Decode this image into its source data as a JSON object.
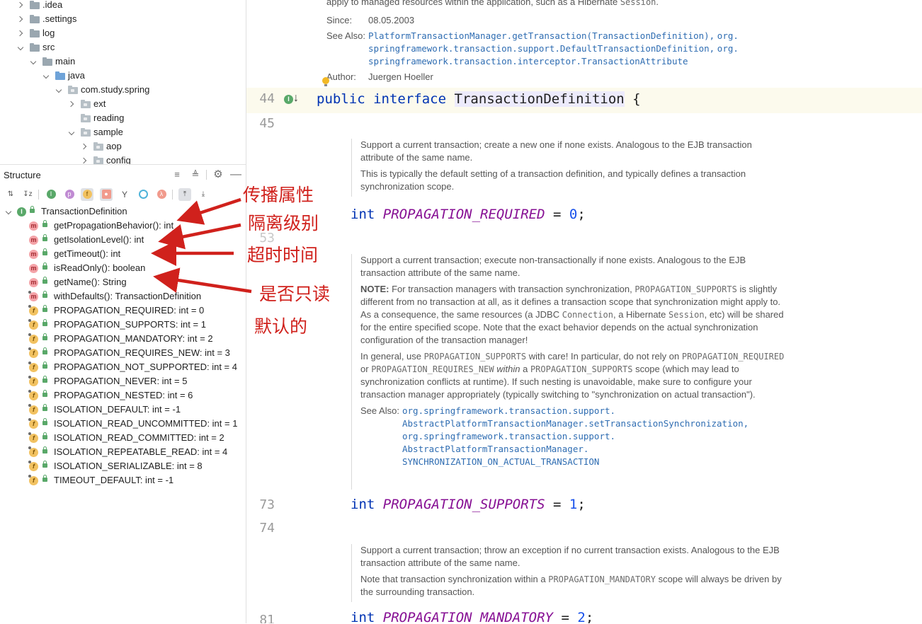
{
  "project_tree": {
    "items": [
      {
        "label": ".idea",
        "type": "folder"
      },
      {
        "label": ".settings",
        "type": "folder"
      },
      {
        "label": "log",
        "type": "folder"
      },
      {
        "label": "src",
        "type": "folder"
      },
      {
        "label": "main",
        "type": "folder"
      },
      {
        "label": "java",
        "type": "source-folder"
      },
      {
        "label": "com.study.spring",
        "type": "package"
      },
      {
        "label": "ext",
        "type": "package"
      },
      {
        "label": "reading",
        "type": "package"
      },
      {
        "label": "sample",
        "type": "package"
      },
      {
        "label": "aop",
        "type": "package"
      },
      {
        "label": "config",
        "type": "package"
      }
    ]
  },
  "structure": {
    "title": "Structure",
    "root": "TransactionDefinition",
    "members": [
      {
        "kind": "method",
        "label": "getPropagationBehavior(): int"
      },
      {
        "kind": "method",
        "label": "getIsolationLevel(): int"
      },
      {
        "kind": "method",
        "label": "getTimeout(): int"
      },
      {
        "kind": "method",
        "label": "isReadOnly(): boolean"
      },
      {
        "kind": "method",
        "label": "getName(): String"
      },
      {
        "kind": "static-method",
        "label": "withDefaults(): TransactionDefinition"
      },
      {
        "kind": "field",
        "label": "PROPAGATION_REQUIRED: int = 0"
      },
      {
        "kind": "field",
        "label": "PROPAGATION_SUPPORTS: int = 1"
      },
      {
        "kind": "field",
        "label": "PROPAGATION_MANDATORY: int = 2"
      },
      {
        "kind": "field",
        "label": "PROPAGATION_REQUIRES_NEW: int = 3"
      },
      {
        "kind": "field",
        "label": "PROPAGATION_NOT_SUPPORTED: int = 4"
      },
      {
        "kind": "field",
        "label": "PROPAGATION_NEVER: int = 5"
      },
      {
        "kind": "field",
        "label": "PROPAGATION_NESTED: int = 6"
      },
      {
        "kind": "field",
        "label": "ISOLATION_DEFAULT: int = -1"
      },
      {
        "kind": "field",
        "label": "ISOLATION_READ_UNCOMMITTED: int = 1"
      },
      {
        "kind": "field",
        "label": "ISOLATION_READ_COMMITTED: int = 2"
      },
      {
        "kind": "field",
        "label": "ISOLATION_REPEATABLE_READ: int = 4"
      },
      {
        "kind": "field",
        "label": "ISOLATION_SERIALIZABLE: int = 8"
      },
      {
        "kind": "field",
        "label": "TIMEOUT_DEFAULT: int = -1"
      }
    ]
  },
  "annotations": {
    "propagation": "传播属性",
    "isolation": "隔离级别",
    "timeout": "超时时间",
    "readonly": "是否只读",
    "default": "默认的",
    "color": "#d0211c"
  },
  "editor": {
    "top_doc": {
      "desc": "apply to managed resources within the application, such as a Hibernate",
      "desc_code": "Session",
      "desc_end": ".",
      "since_label": "Since:",
      "since_value": "08.05.2003",
      "see_also_label": "See Also:",
      "see_also_1": "PlatformTransactionManager.getTransaction(TransactionDefinition),",
      "see_also_2": "org.",
      "see_also_3": "springframework.transaction.support.DefaultTransactionDefinition,",
      "see_also_4": "org.",
      "see_also_5": "springframework.transaction.interceptor.TransactionAttribute",
      "author_label": "Author:",
      "author_value": "Juergen Hoeller"
    },
    "line_44": {
      "num": "44",
      "kw1": "public",
      "kw2": "interface",
      "type": "TransactionDefinition",
      "brace": "{"
    },
    "line_45": "45",
    "doc_required": {
      "p1": "Support a current transaction; create a new one if none exists. Analogous to the EJB transaction attribute of the same name.",
      "p2": "This is typically the default setting of a transaction definition, and typically defines a transaction synchronization scope."
    },
    "code_required": {
      "kw": "int",
      "name": "PROPAGATION_REQUIRED",
      "eq": "=",
      "value": "0",
      "semi": ";"
    },
    "line_53": "53",
    "doc_supports": {
      "p1": "Support a current transaction; execute non-transactionally if none exists. Analogous to the EJB transaction attribute of the same name.",
      "note_label": "NOTE:",
      "p2_a": "For transaction managers with transaction synchronization,",
      "p2_code1": "PROPAGATION_SUPPORTS",
      "p2_b": "is slightly different from no transaction at all, as it defines a transaction scope that synchronization might apply to. As a consequence, the same resources (a JDBC",
      "p2_code2": "Connection",
      "p2_c": ", a Hibernate",
      "p2_code3": "Session",
      "p2_d": ", etc) will be shared for the entire specified scope. Note that the exact behavior depends on the actual synchronization configuration of the transaction manager!",
      "p3_a": "In general, use",
      "p3_code1": "PROPAGATION_SUPPORTS",
      "p3_b": "with care! In particular, do not rely on",
      "p3_code2": "PROPAGATION_REQUIRED",
      "p3_c": "or",
      "p3_code3": "PROPAGATION_REQUIRES_NEW",
      "p3_em": "within",
      "p3_d": "a",
      "p3_code4": "PROPAGATION_SUPPORTS",
      "p3_e": "scope (which may lead to synchronization conflicts at runtime). If such nesting is unavoidable, make sure to configure your transaction manager appropriately (typically switching to \"synchronization on actual transaction\").",
      "see_label": "See Also:",
      "see_1": "org.springframework.transaction.support.",
      "see_2": "AbstractPlatformTransactionManager.setTransactionSynchronization,",
      "see_3": "org.springframework.transaction.support.",
      "see_4": "AbstractPlatformTransactionManager.",
      "see_5": "SYNCHRONIZATION_ON_ACTUAL_TRANSACTION"
    },
    "line_73": "73",
    "code_supports": {
      "kw": "int",
      "name": "PROPAGATION_SUPPORTS",
      "eq": "=",
      "value": "1",
      "semi": ";"
    },
    "line_74": "74",
    "doc_mandatory": {
      "p1": "Support a current transaction; throw an exception if no current transaction exists. Analogous to the EJB transaction attribute of the same name.",
      "p2_a": "Note that transaction synchronization within a",
      "p2_code": "PROPAGATION_MANDATORY",
      "p2_b": "scope will always be driven by the surrounding transaction."
    },
    "line_81": "81",
    "code_mandatory": {
      "kw": "int",
      "name": "PROPAGATION_MANDATORY",
      "eq": "=",
      "value": "2",
      "semi": ";"
    }
  }
}
